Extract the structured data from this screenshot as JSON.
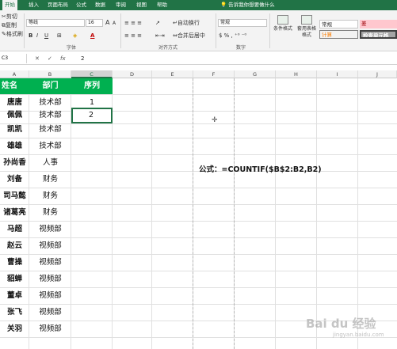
{
  "ribbon": {
    "tabs": [
      "开始",
      "插入",
      "页面布局",
      "公式",
      "数据",
      "审阅",
      "视图",
      "帮助"
    ],
    "tell_me": "告诉我你想要做什么",
    "clipboard": {
      "cut": "剪切",
      "copy": "复制",
      "format_painter": "格式刷"
    },
    "font": {
      "name": "等线",
      "size": "16",
      "group_label": "字体",
      "grow": "A",
      "shrink": "A",
      "bold": "B",
      "italic": "I",
      "underline": "U",
      "font_color_letter": "A"
    },
    "alignment": {
      "wrap_text": "自动换行",
      "merge_center": "合并后居中",
      "group_label": "对齐方式"
    },
    "number": {
      "format": "常规",
      "group_label": "数字"
    },
    "styles": {
      "conditional_format": "条件格式",
      "table_format": "套用表格格式",
      "normal": "常规",
      "bad": "差",
      "calculation": "计算",
      "check_cell": "检查单元格"
    }
  },
  "formula_bar": {
    "name_box": "C3",
    "fx_label": "fx",
    "value": "2"
  },
  "columns": [
    "A",
    "B",
    "C",
    "D",
    "E",
    "F",
    "G",
    "H",
    "I",
    "J"
  ],
  "rows": [
    {
      "name": "姓名",
      "dept": "部门",
      "seq": "序列"
    },
    {
      "name": "唐唐",
      "dept": "技术部",
      "seq": "1"
    },
    {
      "name": "佩佩",
      "dept": "技术部",
      "seq": "2"
    },
    {
      "name": "凯凯",
      "dept": "技术部",
      "seq": ""
    },
    {
      "name": "雄雄",
      "dept": "技术部",
      "seq": ""
    },
    {
      "name": "孙尚香",
      "dept": "人事",
      "seq": ""
    },
    {
      "name": "刘备",
      "dept": "财务",
      "seq": ""
    },
    {
      "name": "司马懿",
      "dept": "财务",
      "seq": ""
    },
    {
      "name": "诸葛亮",
      "dept": "财务",
      "seq": ""
    },
    {
      "name": "马超",
      "dept": "视频部",
      "seq": ""
    },
    {
      "name": "赵云",
      "dept": "视频部",
      "seq": ""
    },
    {
      "name": "曹操",
      "dept": "视频部",
      "seq": ""
    },
    {
      "name": "貂蝉",
      "dept": "视频部",
      "seq": ""
    },
    {
      "name": "董卓",
      "dept": "视频部",
      "seq": ""
    },
    {
      "name": "张飞",
      "dept": "视频部",
      "seq": ""
    },
    {
      "name": "关羽",
      "dept": "视频部",
      "seq": ""
    }
  ],
  "annotation": "公式：=COUNTIF($B$2:B2,B2)",
  "watermark": {
    "brand": "Bai du 经验",
    "url": "jingyan.baidu.com"
  },
  "colors": {
    "ribbon_green": "#217346",
    "header_fill": "#00b050",
    "selection": "#217346",
    "bad_fill": "#ffc7ce",
    "calc_fill": "#f2f2f2",
    "check_fill": "#a5a5a5"
  }
}
